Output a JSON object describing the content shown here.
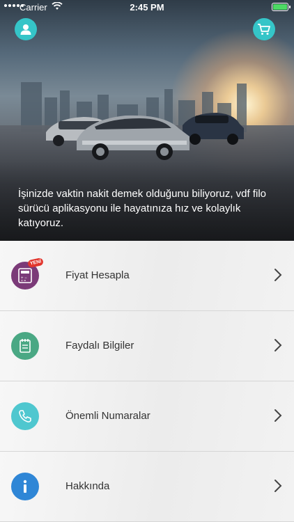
{
  "status_bar": {
    "carrier": "Carrier",
    "time": "2:45 PM"
  },
  "hero": {
    "text": "İşinizde vaktin nakit demek olduğunu biliyoruz, vdf filo sürücü aplikasyonu ile hayatınıza hız ve kolaylık katıyoruz."
  },
  "menu": {
    "items": [
      {
        "label": "Fiyat Hesapla",
        "icon": "calculator-icon",
        "color": "#7b3a78",
        "badge": "YENİ"
      },
      {
        "label": "Faydalı Bilgiler",
        "icon": "notepad-icon",
        "color": "#4aa884"
      },
      {
        "label": "Önemli Numaralar",
        "icon": "phone-icon",
        "color": "#4fc7cf"
      },
      {
        "label": "Hakkında",
        "icon": "info-icon",
        "color": "#2f86d6"
      }
    ]
  },
  "colors": {
    "accent": "#35c5c8"
  }
}
